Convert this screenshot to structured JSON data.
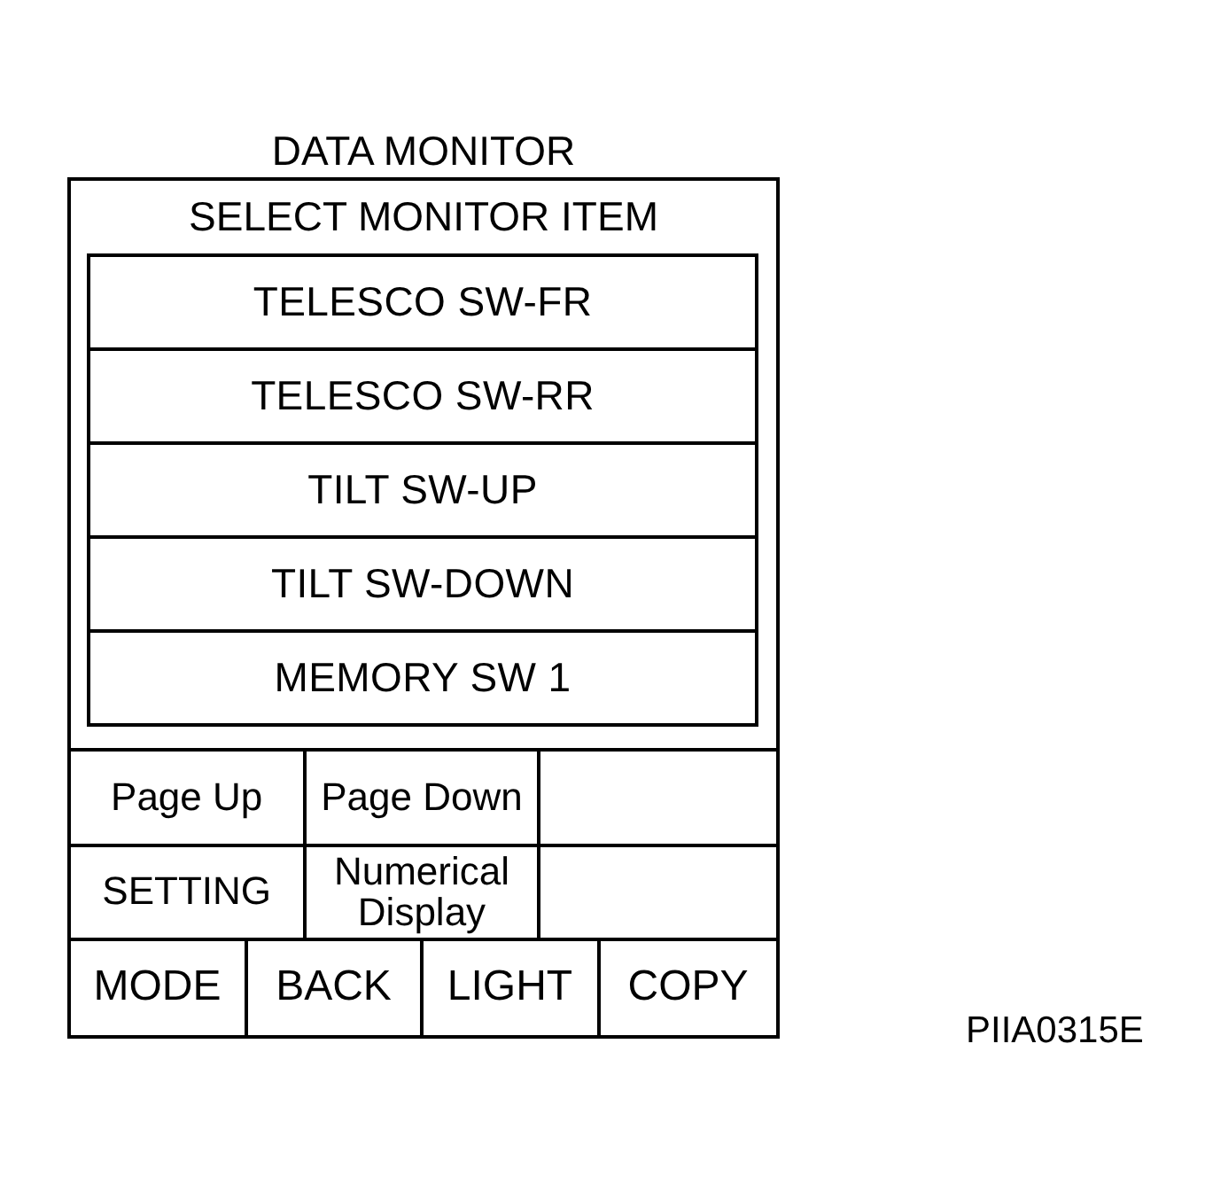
{
  "title": "DATA MONITOR",
  "panel": {
    "heading": "SELECT MONITOR ITEM",
    "items": [
      "TELESCO SW-FR",
      "TELESCO SW-RR",
      "TILT SW-UP",
      "TILT SW-DOWN",
      "MEMORY SW 1"
    ],
    "key_rows": [
      [
        {
          "kind": "button",
          "label": "Page Up"
        },
        {
          "kind": "button",
          "label": "Page Down"
        },
        {
          "kind": "blank"
        }
      ],
      [
        {
          "kind": "button",
          "label": "SETTING"
        },
        {
          "kind": "button",
          "label": "Numerical Display"
        },
        {
          "kind": "blank"
        }
      ],
      [
        {
          "kind": "button",
          "label": "MODE"
        },
        {
          "kind": "button",
          "label": "BACK"
        },
        {
          "kind": "button",
          "label": "LIGHT"
        },
        {
          "kind": "button",
          "label": "COPY"
        }
      ]
    ]
  },
  "code": "PIIA0315E"
}
